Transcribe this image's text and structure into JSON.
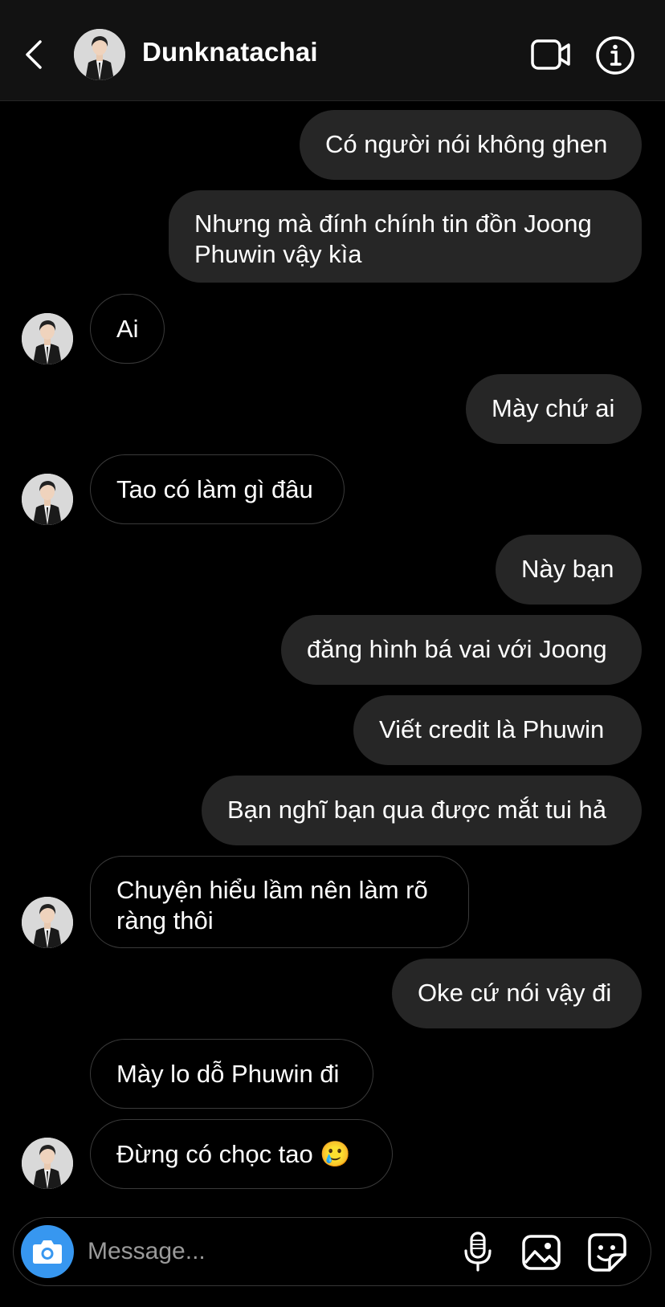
{
  "header": {
    "contact_name": "Dunknatachai",
    "icons": {
      "back": "chevron-left-icon",
      "video": "video-camera-icon",
      "info": "info-icon"
    }
  },
  "messages": [
    {
      "side": "out",
      "text": "Có người nói không ghen"
    },
    {
      "side": "out",
      "text": "Nhưng mà đính chính tin đồn Joong Phuwin vậy kìa"
    },
    {
      "side": "in",
      "text": "Ai"
    },
    {
      "side": "out",
      "text": "Mày chứ ai"
    },
    {
      "side": "in",
      "text": "Tao có làm gì đâu"
    },
    {
      "side": "out",
      "text": "Này bạn"
    },
    {
      "side": "out",
      "text": "đăng hình bá vai với Joong"
    },
    {
      "side": "out",
      "text": "Viết credit là Phuwin"
    },
    {
      "side": "out",
      "text": "Bạn nghĩ bạn qua được mắt tui hả"
    },
    {
      "side": "in",
      "text": "Chuyện hiểu lầm nên làm rõ ràng thôi"
    },
    {
      "side": "out",
      "text": "Oke cứ nói vậy đi"
    },
    {
      "side": "in",
      "text": "Mày lo dỗ Phuwin đi"
    },
    {
      "side": "in",
      "text": "Đừng có chọc tao 🥲"
    }
  ],
  "composer": {
    "placeholder": "Message...",
    "icons": [
      "camera-icon",
      "microphone-icon",
      "photo-gallery-icon",
      "sticker-icon"
    ]
  },
  "colors": {
    "outgoing_bubble": "#262626",
    "header_bg": "#121212",
    "camera_button": "#3797f0"
  }
}
